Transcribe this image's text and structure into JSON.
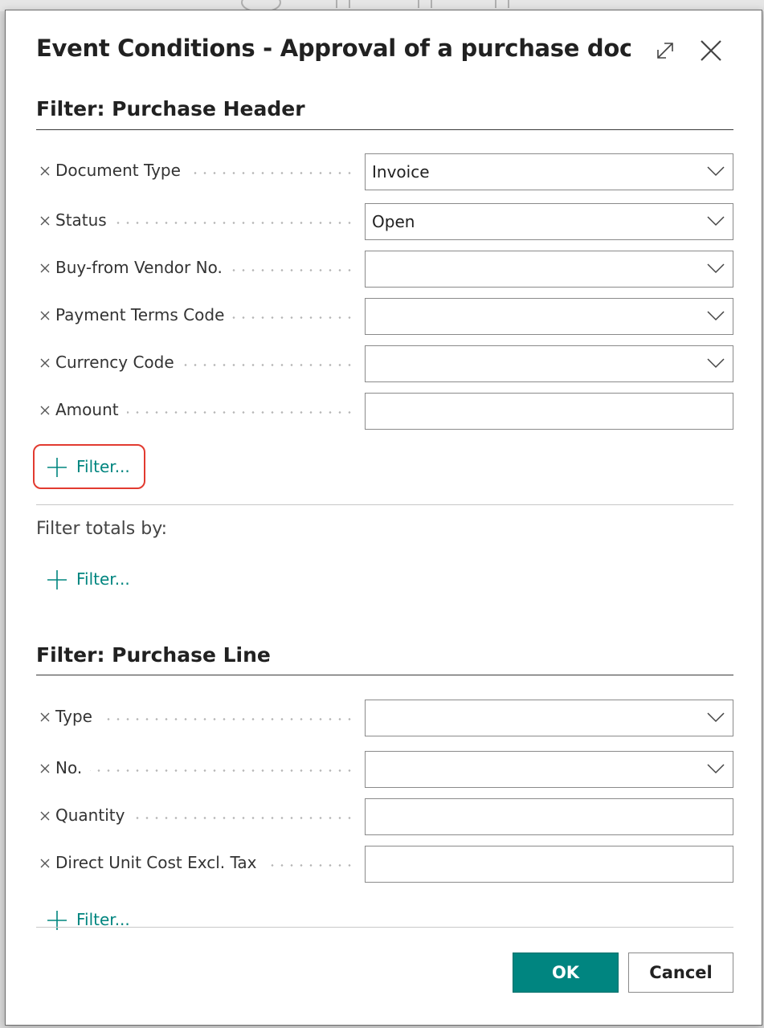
{
  "dialog": {
    "title": "Event Conditions - Approval of a purchase docu...",
    "expand_icon": "expand-icon",
    "close_icon": "close-icon"
  },
  "header_section": {
    "title": "Filter: Purchase Header",
    "rows": [
      {
        "label": "Document Type",
        "value": "Invoice",
        "dropdown": true
      },
      {
        "label": "Status",
        "value": "Open",
        "dropdown": true
      },
      {
        "label": "Buy-from Vendor No.",
        "value": "",
        "dropdown": true
      },
      {
        "label": "Payment Terms Code",
        "value": "",
        "dropdown": true
      },
      {
        "label": "Currency Code",
        "value": "",
        "dropdown": true
      },
      {
        "label": "Amount",
        "value": "",
        "dropdown": false
      }
    ],
    "add_filter_label": "Filter...",
    "totals_label": "Filter totals by:",
    "totals_filter_label": "Filter..."
  },
  "line_section": {
    "title": "Filter: Purchase Line",
    "rows": [
      {
        "label": "Type",
        "value": "",
        "dropdown": true
      },
      {
        "label": "No.",
        "value": "",
        "dropdown": true
      },
      {
        "label": "Quantity",
        "value": "",
        "dropdown": false
      },
      {
        "label": "Direct Unit Cost Excl. Tax",
        "value": "",
        "dropdown": false
      }
    ],
    "add_filter_label": "Filter..."
  },
  "buttons": {
    "ok": "OK",
    "cancel": "Cancel"
  },
  "colors": {
    "accent": "#008580",
    "highlight": "#e23b30"
  }
}
